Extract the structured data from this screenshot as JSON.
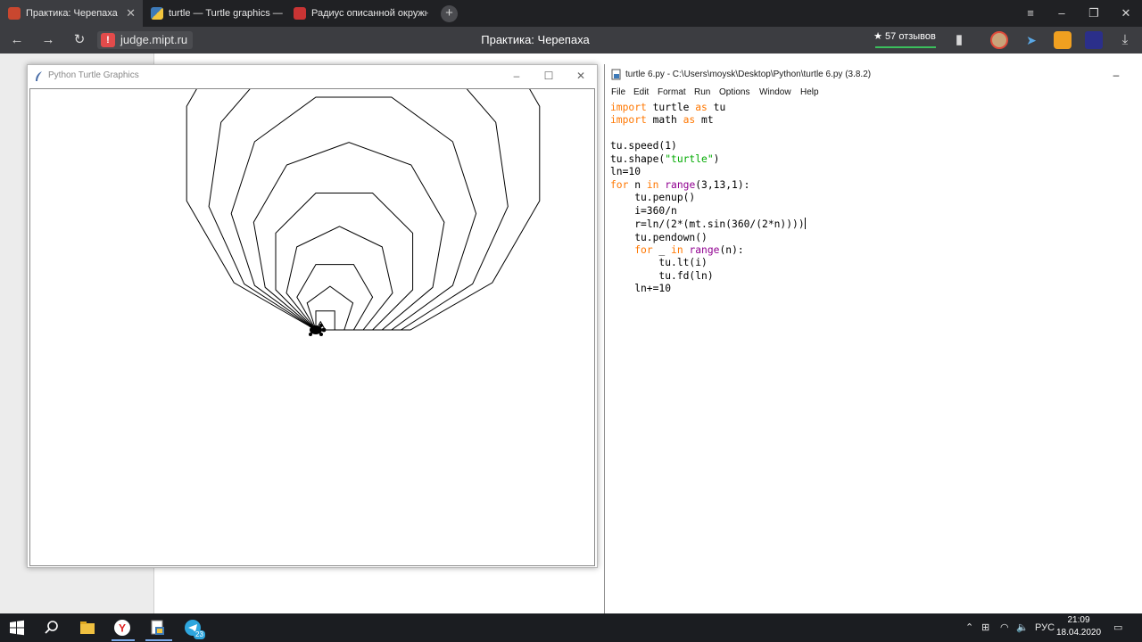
{
  "browser": {
    "tabs": [
      {
        "label": "Практика: Черепаха",
        "active": true
      },
      {
        "label": "turtle — Turtle graphics —",
        "active": false
      },
      {
        "label": "Радиус описанной окружн",
        "active": false
      }
    ],
    "address": "judge.mipt.ru",
    "page_title": "Практика: Черепаха",
    "reviews": "★ 57 отзывов"
  },
  "turtle_window": {
    "title": "Python Turtle Graphics",
    "drawing": {
      "polygon_sides_from": 3,
      "polygon_sides_to": 12,
      "side_length_start": 10,
      "side_length_step": 10
    }
  },
  "idle_window": {
    "title": "turtle 6.py - C:\\Users\\moysk\\Desktop\\Python\\turtle 6.py (3.8.2)",
    "menu": [
      "File",
      "Edit",
      "Format",
      "Run",
      "Options",
      "Window",
      "Help"
    ]
  },
  "taskbar": {
    "lang": "РУС",
    "time": "21:09",
    "date": "18.04.2020",
    "telegram_badge": "23"
  },
  "colors": {
    "keyword": "#ff7700",
    "builtin": "#900090",
    "string": "#00aa00",
    "chrome_dark": "#202124"
  }
}
